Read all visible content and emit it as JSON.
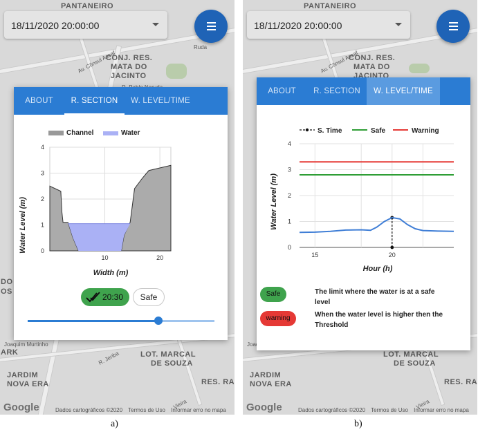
{
  "panels": [
    {
      "map": {
        "labels": [
          "PANTANEIRO",
          "CONJ. RES.",
          "MATA DO",
          "JACINTO",
          "Av. Cônsul Assaf",
          "R. Pablo Neruda",
          "Ruda",
          "LOT. MARCAL",
          "DE SOUZA",
          "JARDIM",
          "NOVA ERA",
          "RES. RA",
          "DO",
          "OS",
          "ARK",
          "Joaquim Murtinho",
          "R. Jeriba",
          "Vieira"
        ],
        "google": "Google",
        "footer": [
          "Dados cartográficos ©2020",
          "Termos de Uso",
          "Informar erro no mapa"
        ]
      },
      "date_value": "18/11/2020 20:00:00",
      "tabs": [
        "ABOUT",
        "R. SECTION",
        "W. LEVEL/TIME"
      ],
      "active_tab": 1,
      "chart_data": {
        "type": "area",
        "xlabel": "Width (m)",
        "ylabel": "Water Level (m)",
        "xlim": [
          0,
          22
        ],
        "ylim": [
          0,
          4
        ],
        "xticks": [
          10,
          20
        ],
        "yticks": [
          0,
          1,
          2,
          3,
          4
        ],
        "legend_placement": "top",
        "series": [
          {
            "name": "Channel",
            "color": "#888888",
            "x": [
              0,
              2,
              2.2,
              2.4,
              3.3,
              4.2,
              5.2,
              13,
              13.5,
              14.6,
              15.4,
              16.8,
              18,
              22
            ],
            "y": [
              2.5,
              2.3,
              1.5,
              1.1,
              1.1,
              0.5,
              0,
              0,
              0.6,
              1.1,
              2.4,
              2.8,
              3.1,
              3.3
            ]
          },
          {
            "name": "Water",
            "color": "#aab1f5",
            "level": 1.05
          }
        ],
        "grid": true
      },
      "time_chip": "20:30",
      "status_chip": "Safe",
      "slider": {
        "value": 0.7
      },
      "caption": "a)"
    },
    {
      "map": {
        "labels": [
          "PANTANEIRO",
          "CONJ. RES.",
          "MATA DO",
          "JACINTO",
          "Av. Cônsul Assaf",
          "LOT. MARCAL",
          "DE SOUZA",
          "JARDIM",
          "NOVA ERA",
          "RES. RA",
          "Vieira",
          "Joaquim Murtinho"
        ],
        "google": "Google",
        "footer": [
          "Dados cartográficos ©2020",
          "Termos de Uso",
          "Informar erro no mapa"
        ]
      },
      "date_value": "18/11/2020 20:00:00",
      "tabs": [
        "ABOUT",
        "R. SECTION",
        "W. LEVEL/TIME"
      ],
      "active_tab": 2,
      "chart_data": {
        "type": "line",
        "xlabel": "Hour (h)",
        "ylabel": "Water Level (m)",
        "xlim": [
          14,
          24
        ],
        "ylim": [
          0,
          4
        ],
        "xticks": [
          15,
          20
        ],
        "yticks": [
          0,
          1,
          2,
          3,
          4
        ],
        "legend_placement": "top",
        "series": [
          {
            "name": "S. Time",
            "color": "#111111",
            "x": [
              20,
              20
            ],
            "y": [
              0,
              1.15
            ],
            "style": "dashed"
          },
          {
            "name": "Safe",
            "color": "#2e9e35",
            "x": [
              14,
              24
            ],
            "y": [
              2.8,
              2.8
            ]
          },
          {
            "name": "Warning",
            "color": "#e53935",
            "x": [
              14,
              24
            ],
            "y": [
              3.3,
              3.3
            ]
          },
          {
            "name": "",
            "color": "#3f7ed6",
            "x": [
              14,
              15,
              16,
              17,
              18,
              18.6,
              19,
              19.5,
              20,
              20.5,
              21,
              21.5,
              22,
              23,
              24
            ],
            "y": [
              0.58,
              0.59,
              0.62,
              0.67,
              0.68,
              0.66,
              0.78,
              1.0,
              1.15,
              1.1,
              0.88,
              0.72,
              0.65,
              0.63,
              0.62
            ]
          }
        ],
        "grid": true
      },
      "legend_items": [
        {
          "chip": "Safe",
          "color": "#3fa34d",
          "text": "The limit where the water is at a safe level"
        },
        {
          "chip": "warning",
          "color": "#e53935",
          "text": "When the water level is higher then the Threshold"
        }
      ],
      "caption": "b)"
    }
  ]
}
